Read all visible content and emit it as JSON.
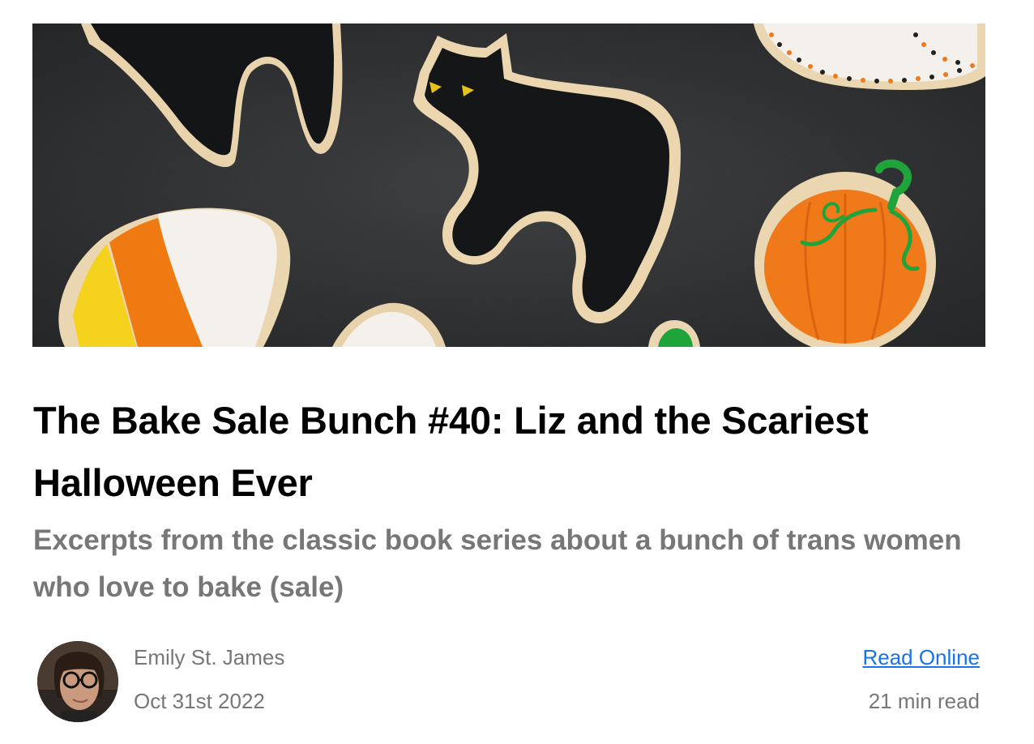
{
  "post": {
    "title": "The Bake Sale Bunch #40: Liz and the Scariest Halloween Ever",
    "subtitle": "Excerpts from the classic book series about a bunch of trans women who love to bake (sale)",
    "author_name": "Emily St. James",
    "date": "Oct 31st 2022",
    "read_online_label": "Read Online",
    "read_time": "21 min read"
  },
  "colors": {
    "title": "#000000",
    "muted_text": "#777777",
    "link": "#1a73e8",
    "hero_background": "#2a2b2c"
  }
}
